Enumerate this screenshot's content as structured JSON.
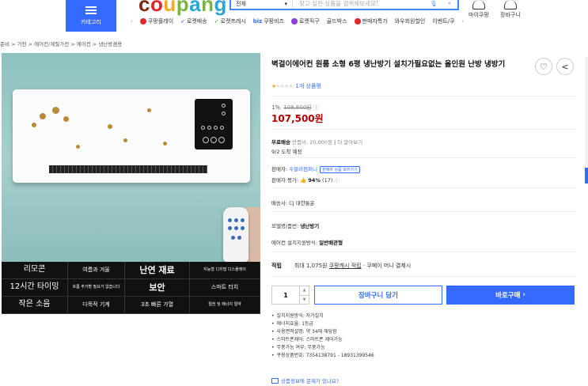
{
  "header": {
    "category_label": "카테고리",
    "logo": "coupang",
    "search": {
      "select_value": "전체",
      "placeholder": "찾고 싶은 상품을 검색해보세요!"
    },
    "my_coupang": "마이쿠팡",
    "cart": "장바구니",
    "menu": [
      {
        "label": "쿠팡플레이",
        "icon": "play-icon",
        "color": "#e3262c"
      },
      {
        "label": "로켓배송",
        "icon": "rocket-icon",
        "color": "#346aff"
      },
      {
        "label": "로켓프레시",
        "icon": "rocket-fresh-icon",
        "color": "#38a33a"
      },
      {
        "label": "쿠팡비즈",
        "icon": "biz-icon",
        "prefix": "biz",
        "color": "#346aff"
      },
      {
        "label": "로켓직구",
        "icon": "globe-icon",
        "color": "#8b3ed8"
      },
      {
        "label": "골드박스",
        "icon": "",
        "color": ""
      },
      {
        "label": "판매자특가",
        "icon": "percent-icon",
        "color": "#e3262c"
      },
      {
        "label": "와우회원할인",
        "icon": "",
        "color": ""
      },
      {
        "label": "이벤트/쿠",
        "icon": "",
        "color": ""
      }
    ]
  },
  "breadcrumb": [
    "준비",
    "가전",
    "에어컨/계절가전",
    "에어컨",
    "냉난방겸용"
  ],
  "product_image": {
    "features": [
      [
        "리모콘",
        "여름과 겨울",
        "난연 재료",
        "지능형 디지털 디스플레이"
      ],
      [
        "12시간 타이밍",
        "흐름 추가할 필요가 없습니다",
        "보안",
        "스마트 터치"
      ],
      [
        "작은 소음",
        "다목적 기계",
        "3초 빠른 가열",
        "절전 및 에너지 절약"
      ]
    ]
  },
  "product": {
    "title": "벽걸이에어컨 원룸 소형 6평 냉난방기 설치가필요없는 올인원 난방 냉방기",
    "rating": 1,
    "review_count": "1개 상품평",
    "discount_rate": "1%",
    "original_price": "108,600원",
    "price": "107,500원",
    "shipping_label": "무료배송",
    "shipping_note": "반품비: 20,000원",
    "shipping_more": "더 알아보기",
    "arrival": "9/2 도착 예정",
    "seller_label": "판매자:",
    "seller_name": "수블리컴퍼니",
    "seller_tag": "판매자 상품 보러가기",
    "seller_rating_label": "판매자 평가:",
    "seller_rating_value": "94%",
    "seller_rating_count": "(17)",
    "delivery_company": "배송사: CJ 대한통운",
    "model_label": "모델명/품번:",
    "model_value": "냉난방기",
    "install_label": "에어컨 설치지원방식:",
    "install_value": "일반배관형",
    "reward_label": "적립",
    "reward_text_prefix": "최대 1,075원",
    "reward_link": "쿠팡캐시 적립",
    "reward_suffix": "· 쿠페이 머니 결제시",
    "quantity": "1",
    "cart_button": "장바구니 담기",
    "buy_button": "바로구매",
    "specs": [
      "설치지원방식: 자가설치",
      "에너지효율: 1등급",
      "사용면적설명: 약 34에 해당함",
      "스마트폰제어: 스마트폰 제어가능",
      "무풍가능 여부: 무풍가능",
      "쿠팡상품번호: 7354138791 - 18931399546"
    ],
    "report_link": "상품정보에 문제가 있나요?"
  }
}
